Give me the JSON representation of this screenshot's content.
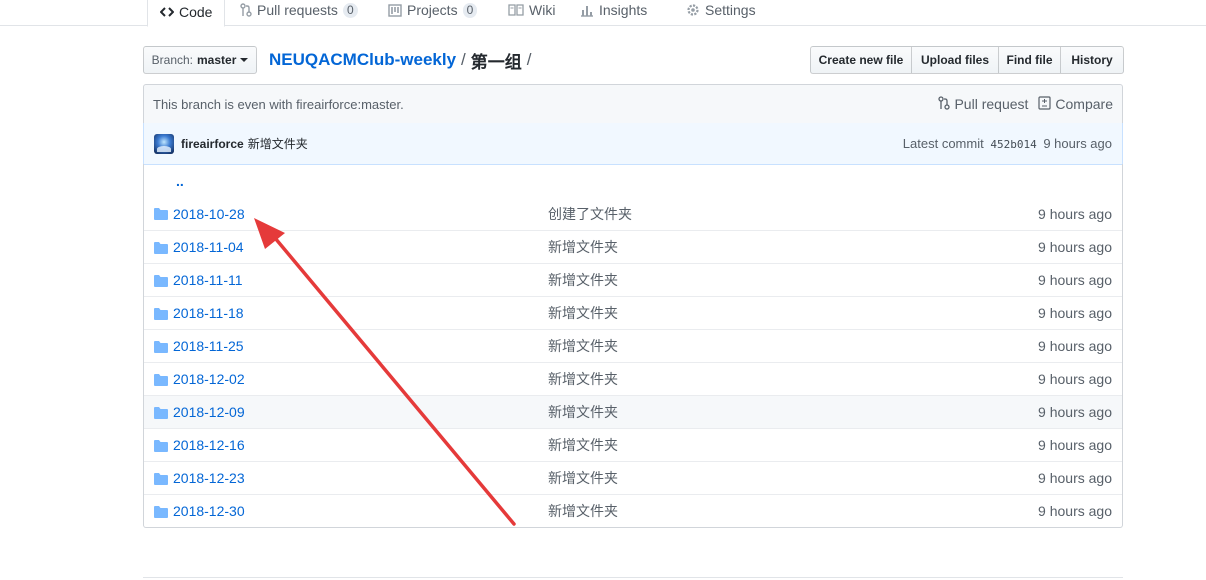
{
  "tabs": [
    {
      "label": "Code",
      "icon": "code-icon",
      "selected": true
    },
    {
      "label": "Pull requests",
      "icon": "pull-request-icon",
      "count": "0"
    },
    {
      "label": "Projects",
      "icon": "project-icon",
      "count": "0"
    },
    {
      "label": "Wiki",
      "icon": "book-icon"
    },
    {
      "label": "Insights",
      "icon": "graph-icon"
    },
    {
      "label": "Settings",
      "icon": "gear-icon"
    }
  ],
  "branch": {
    "label": "Branch:",
    "value": "master"
  },
  "breadcrumb": {
    "repo": "NEUQACMClub-weekly",
    "separator": "/",
    "folder": "第一组",
    "trailing": "/"
  },
  "file_actions": {
    "create": "Create new file",
    "upload": "Upload files",
    "find": "Find file",
    "history": "History"
  },
  "branch_info": {
    "text": "This branch is even with fireairforce:master.",
    "pull_request": "Pull request",
    "compare": "Compare"
  },
  "commit": {
    "author": "fireairforce",
    "message": "新增文件夹",
    "prefix": "Latest commit",
    "sha": "452b014",
    "age": "9 hours ago"
  },
  "parent_dir": "..",
  "files": [
    {
      "name": "2018-10-28",
      "message": "创建了文件夹",
      "age": "9 hours ago"
    },
    {
      "name": "2018-11-04",
      "message": "新增文件夹",
      "age": "9 hours ago"
    },
    {
      "name": "2018-11-11",
      "message": "新增文件夹",
      "age": "9 hours ago"
    },
    {
      "name": "2018-11-18",
      "message": "新增文件夹",
      "age": "9 hours ago"
    },
    {
      "name": "2018-11-25",
      "message": "新增文件夹",
      "age": "9 hours ago"
    },
    {
      "name": "2018-12-02",
      "message": "新增文件夹",
      "age": "9 hours ago"
    },
    {
      "name": "2018-12-09",
      "message": "新增文件夹",
      "age": "9 hours ago"
    },
    {
      "name": "2018-12-16",
      "message": "新增文件夹",
      "age": "9 hours ago"
    },
    {
      "name": "2018-12-23",
      "message": "新增文件夹",
      "age": "9 hours ago"
    },
    {
      "name": "2018-12-30",
      "message": "新增文件夹",
      "age": "9 hours ago"
    }
  ],
  "colors": {
    "link": "#0366d6",
    "arrow": "#e53a3a",
    "selected_tab": "#e36209",
    "folder": "#79b8ff"
  }
}
